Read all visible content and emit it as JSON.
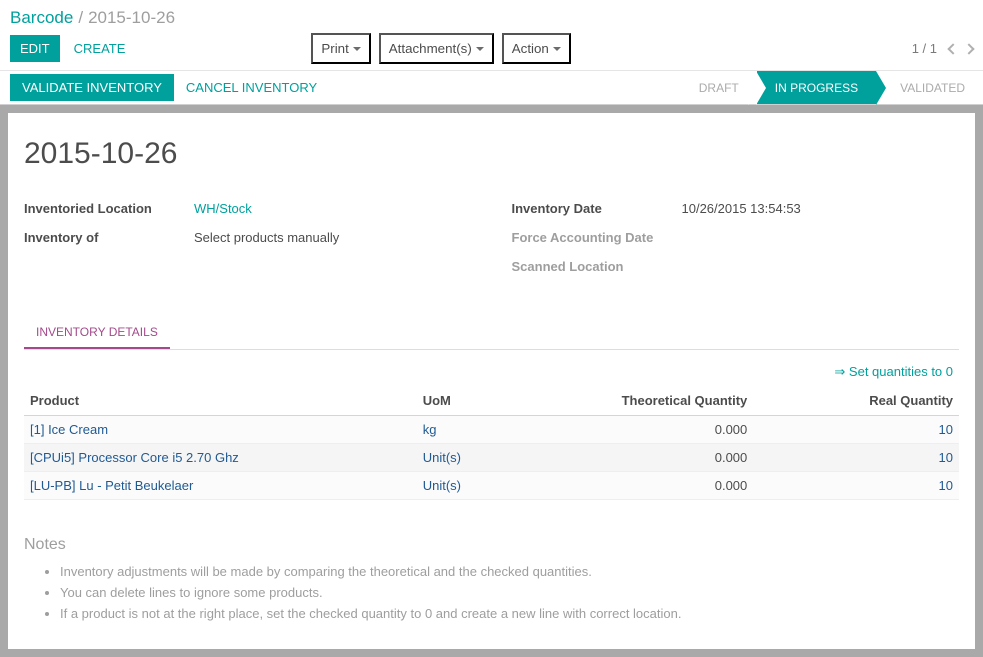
{
  "breadcrumb": {
    "root": "Barcode",
    "current": "2015-10-26"
  },
  "actions": {
    "edit": "EDIT",
    "create": "CREATE",
    "print": "Print",
    "attachments": "Attachment(s)",
    "action": "Action"
  },
  "pager": {
    "text": "1 / 1"
  },
  "status_buttons": {
    "validate": "VALIDATE INVENTORY",
    "cancel": "CANCEL INVENTORY"
  },
  "status_stages": {
    "draft": "DRAFT",
    "in_progress": "IN PROGRESS",
    "validated": "VALIDATED"
  },
  "record": {
    "title": "2015-10-26",
    "labels": {
      "inventoried_location": "Inventoried Location",
      "inventory_of": "Inventory of",
      "inventory_date": "Inventory Date",
      "force_accounting_date": "Force Accounting Date",
      "scanned_location": "Scanned Location"
    },
    "values": {
      "inventoried_location": "WH/Stock",
      "inventory_of": "Select products manually",
      "inventory_date": "10/26/2015 13:54:53",
      "force_accounting_date": "",
      "scanned_location": ""
    }
  },
  "tab_label": "INVENTORY DETAILS",
  "set_zero": "⇒ Set quantities to 0",
  "table": {
    "headers": {
      "product": "Product",
      "uom": "UoM",
      "theoretical": "Theoretical Quantity",
      "real": "Real Quantity"
    },
    "rows": [
      {
        "product": "[1] Ice Cream",
        "uom": "kg",
        "theoretical": "0.000",
        "real": "10"
      },
      {
        "product": "[CPUi5] Processor Core i5 2.70 Ghz",
        "uom": "Unit(s)",
        "theoretical": "0.000",
        "real": "10"
      },
      {
        "product": "[LU-PB] Lu - Petit Beukelaer",
        "uom": "Unit(s)",
        "theoretical": "0.000",
        "real": "10"
      }
    ]
  },
  "notes": {
    "title": "Notes",
    "items": [
      "Inventory adjustments will be made by comparing the theoretical and the checked quantities.",
      "You can delete lines to ignore some products.",
      "If a product is not at the right place, set the checked quantity to 0 and create a new line with correct location."
    ]
  }
}
